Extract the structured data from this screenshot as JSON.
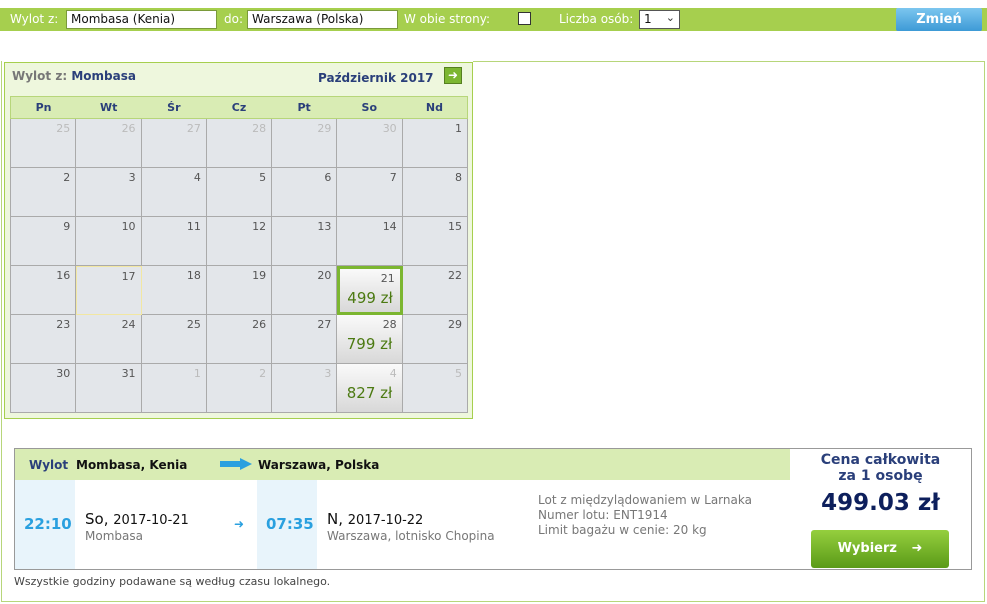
{
  "search": {
    "from_label": "Wylot z:",
    "from_value": "Mombasa (Kenia)",
    "to_label": "do:",
    "to_value": "Warszawa (Polska)",
    "roundtrip_label": "W obie strony:",
    "roundtrip_checked": false,
    "persons_label": "Liczba osób:",
    "persons_value": "1",
    "submit_label": "Zmień"
  },
  "calendar": {
    "from_prefix": "Wylot z:",
    "from_city": "Mombasa",
    "month": "Październik 2017",
    "weekdays": [
      "Pn",
      "Wt",
      "Śr",
      "Cz",
      "Pt",
      "So",
      "Nd"
    ],
    "rows": [
      [
        {
          "d": "25",
          "other": true
        },
        {
          "d": "26",
          "other": true
        },
        {
          "d": "27",
          "other": true
        },
        {
          "d": "28",
          "other": true
        },
        {
          "d": "29",
          "other": true
        },
        {
          "d": "30",
          "other": true
        },
        {
          "d": "1"
        }
      ],
      [
        {
          "d": "2"
        },
        {
          "d": "3"
        },
        {
          "d": "4"
        },
        {
          "d": "5"
        },
        {
          "d": "6"
        },
        {
          "d": "7"
        },
        {
          "d": "8"
        }
      ],
      [
        {
          "d": "9"
        },
        {
          "d": "10"
        },
        {
          "d": "11"
        },
        {
          "d": "12"
        },
        {
          "d": "13"
        },
        {
          "d": "14"
        },
        {
          "d": "15"
        }
      ],
      [
        {
          "d": "16"
        },
        {
          "d": "17",
          "today": true
        },
        {
          "d": "18"
        },
        {
          "d": "19"
        },
        {
          "d": "20"
        },
        {
          "d": "21",
          "price": "499 zł",
          "selected": true
        },
        {
          "d": "22"
        }
      ],
      [
        {
          "d": "23"
        },
        {
          "d": "24"
        },
        {
          "d": "25"
        },
        {
          "d": "26"
        },
        {
          "d": "27"
        },
        {
          "d": "28",
          "price": "799 zł"
        },
        {
          "d": "29"
        }
      ],
      [
        {
          "d": "30"
        },
        {
          "d": "31"
        },
        {
          "d": "1",
          "other": true
        },
        {
          "d": "2",
          "other": true
        },
        {
          "d": "3",
          "other": true
        },
        {
          "d": "4",
          "other": true,
          "price": "827 zł"
        },
        {
          "d": "5",
          "other": true
        }
      ]
    ]
  },
  "flight": {
    "header_label": "Wylot",
    "from": "Mombasa, Kenia",
    "to": "Warszawa, Polska",
    "dep_time": "22:10",
    "dep_day": "So,",
    "dep_date": "2017-10-21",
    "dep_place": "Mombasa",
    "arr_time": "07:35",
    "arr_day": "N,",
    "arr_date": "2017-10-22",
    "arr_place": "Warszawa, lotnisko Chopina",
    "info_line1": "Lot z międzylądowaniem w Larnaka",
    "info_line2": "Numer lotu: ENT1914",
    "info_line3": "Limit bagażu w cenie: 20 kg",
    "price_title_1": "Cena całkowita",
    "price_title_2": "za 1 osobę",
    "price": "499.03 zł",
    "choose_label": "Wybierz"
  },
  "footnote": "Wszystkie godziny podawane są według czasu lokalnego.",
  "colors": {
    "accent_green": "#a6cf4e",
    "button_blue": "#3d9ad6",
    "time_blue": "#2aa0df",
    "navy": "#2a3f7a"
  }
}
